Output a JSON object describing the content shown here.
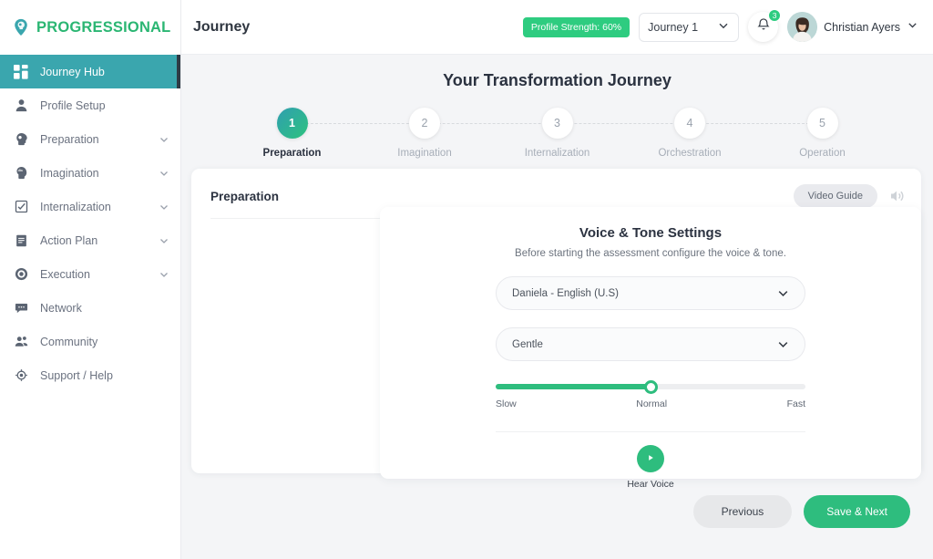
{
  "sidebar": {
    "logo_text": "PROGRESSIONAL",
    "items": [
      {
        "label": "Journey Hub",
        "icon": "grid-icon",
        "active": true,
        "expandable": false
      },
      {
        "label": "Profile Setup",
        "icon": "person-icon",
        "active": false,
        "expandable": false
      },
      {
        "label": "Preparation",
        "icon": "head-bulb-icon",
        "active": false,
        "expandable": true
      },
      {
        "label": "Imagination",
        "icon": "head-cloud-icon",
        "active": false,
        "expandable": true
      },
      {
        "label": "Internalization",
        "icon": "checklist-icon",
        "active": false,
        "expandable": true
      },
      {
        "label": "Action Plan",
        "icon": "clipboard-icon",
        "active": false,
        "expandable": true
      },
      {
        "label": "Execution",
        "icon": "target-gear-icon",
        "active": false,
        "expandable": true
      },
      {
        "label": "Network",
        "icon": "chat-icon",
        "active": false,
        "expandable": false
      },
      {
        "label": "Community",
        "icon": "people-icon",
        "active": false,
        "expandable": false
      },
      {
        "label": "Support / Help",
        "icon": "lifebuoy-icon",
        "active": false,
        "expandable": false
      }
    ]
  },
  "topbar": {
    "page_title": "Journey",
    "profile_strength": "Profile Strength: 60%",
    "journey_select_value": "Journey 1",
    "notification_count": "3",
    "user_name": "Christian Ayers"
  },
  "journey": {
    "heading": "Your Transformation Journey",
    "steps": [
      {
        "number": "1",
        "label": "Preparation",
        "state": "current"
      },
      {
        "number": "2",
        "label": "Imagination",
        "state": "upcoming"
      },
      {
        "number": "3",
        "label": "Internalization",
        "state": "upcoming"
      },
      {
        "number": "4",
        "label": "Orchestration",
        "state": "upcoming"
      },
      {
        "number": "5",
        "label": "Operation",
        "state": "upcoming"
      }
    ]
  },
  "card": {
    "title": "Preparation",
    "video_guide_label": "Video Guide"
  },
  "form": {
    "title": "Voice & Tone Settings",
    "subtitle": "Before starting the assessment configure the voice & tone.",
    "voice_value": "Daniela - English (U.S)",
    "tone_value": "Gentle",
    "speed": {
      "percent": 50,
      "label_min": "Slow",
      "label_mid": "Normal",
      "label_max": "Fast"
    },
    "hear_voice_label": "Hear Voice"
  },
  "footer": {
    "previous_label": "Previous",
    "next_label": "Save & Next"
  },
  "colors": {
    "green": "#2ebd7e",
    "teal": "#3aa6ae",
    "bg": "#f4f5f7"
  }
}
